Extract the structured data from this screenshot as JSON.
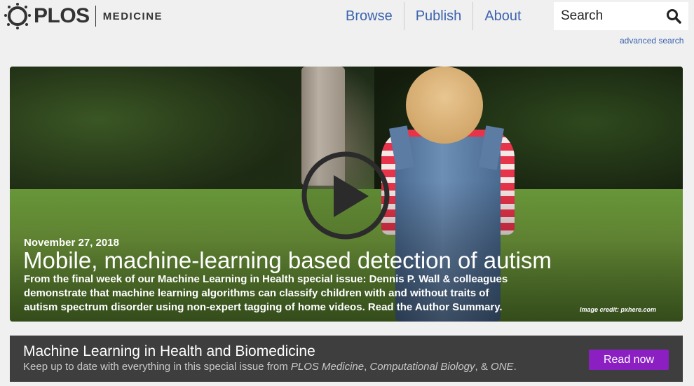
{
  "logo": {
    "brand": "PLOS",
    "journal": "MEDICINE"
  },
  "nav": {
    "items": [
      {
        "label": "Browse"
      },
      {
        "label": "Publish"
      },
      {
        "label": "About"
      }
    ]
  },
  "search": {
    "placeholder": "Search",
    "advanced_label": "advanced search"
  },
  "hero": {
    "date": "November 27, 2018",
    "title": "Mobile, machine-learning based detection of autism",
    "summary": "From the final week of our Machine Learning in Health special issue: Dennis P. Wall & colleagues demonstrate that machine learning algorithms can classify children with and without traits of autism spectrum disorder using non-expert tagging of home videos. Read the Author Summary.",
    "image_credit": "Image credit: pxhere.com"
  },
  "banner": {
    "title": "Machine Learning in Health and Biomedicine",
    "desc_prefix": "Keep up to date with everything in this special issue from ",
    "journal1": "PLOS Medicine",
    "sep1": ", ",
    "journal2": "Computational Biology",
    "sep2": ", & ",
    "journal3": "ONE",
    "desc_suffix": ".",
    "button_label": "Read now"
  },
  "colors": {
    "link": "#3c63af",
    "button": "#8b1fc2",
    "banner_bg": "#3e3e3e",
    "page_bg": "#f0f0f0"
  }
}
